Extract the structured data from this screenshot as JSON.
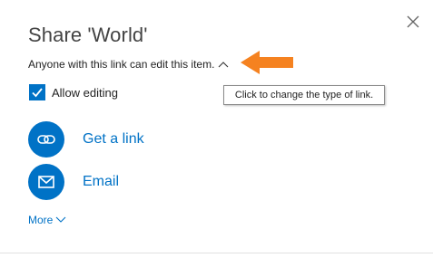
{
  "dialog": {
    "title": "Share 'World'",
    "link_description": "Anyone with this link can edit this item.",
    "tooltip": "Click to change the type of link.",
    "allow_editing": {
      "label": "Allow editing",
      "checked": true
    },
    "options": [
      {
        "label": "Get a link",
        "icon": "link-icon"
      },
      {
        "label": "Email",
        "icon": "envelope-icon"
      }
    ],
    "more_label": "More"
  },
  "colors": {
    "accent": "#0072c6",
    "annotation_arrow": "#f58220"
  }
}
